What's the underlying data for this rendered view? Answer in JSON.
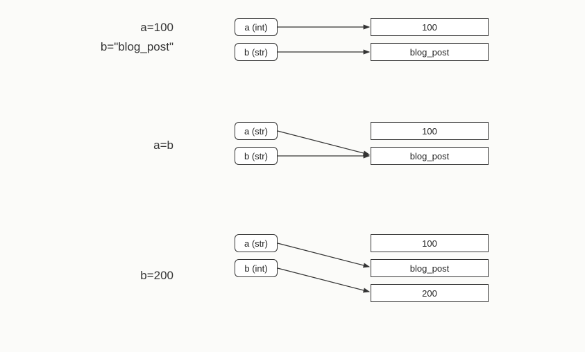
{
  "stage1": {
    "code_a": "a=100",
    "code_b": "b=\"blog_post\"",
    "var_a": "a (int)",
    "var_b": "b (str)",
    "val_1": "100",
    "val_2": "blog_post"
  },
  "stage2": {
    "code": "a=b",
    "var_a": "a (str)",
    "var_b": "b (str)",
    "val_1": "100",
    "val_2": "blog_post"
  },
  "stage3": {
    "code": "b=200",
    "var_a": "a (str)",
    "var_b": "b (int)",
    "val_1": "100",
    "val_2": "blog_post",
    "val_3": "200"
  }
}
